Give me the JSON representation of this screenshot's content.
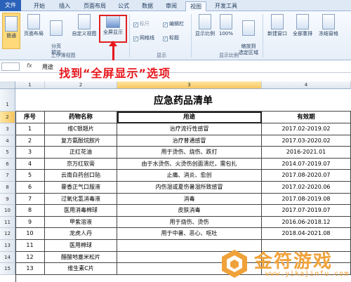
{
  "tabs": [
    "文件",
    "开始",
    "插入",
    "页面布局",
    "公式",
    "数据",
    "审阅",
    "视图",
    "开发工具"
  ],
  "active_tab": "视图",
  "ribbon": {
    "workbook_views": {
      "group_label": "工作簿视图",
      "normal": "普通",
      "page_layout": "页面布局",
      "page_break_preview": "分页\n预览",
      "custom_views": "自定义视图",
      "full_screen": "全屏显示"
    },
    "show": {
      "group_label": "显示",
      "ruler": "标尺",
      "gridlines": "网格线",
      "formula_bar": "编辑栏",
      "headings": "标题"
    },
    "zoom": {
      "group_label": "显示比例",
      "zoom": "显示比例",
      "hundred": "100%",
      "zoom_to_selection": "缩放到\n选定区域"
    },
    "window": {
      "new_window": "新建窗口",
      "arrange_all": "全部重排",
      "freeze_panes": "冻结窗格"
    }
  },
  "formula_bar": {
    "fx": "fx",
    "content": "用途"
  },
  "annotation": "找到“全屏显示”选项",
  "columns": [
    "1",
    "2",
    "3",
    "4"
  ],
  "sheet": {
    "title": "应急药品清单",
    "headers": [
      "序号",
      "药物名称",
      "用途",
      "有效期"
    ],
    "rows": [
      [
        "1",
        "维C银翘片",
        "治疗流行性感冒",
        "2017.02-2019.02"
      ],
      [
        "2",
        "复方氨酚烷胺片",
        "治疗普通感冒",
        "2017.03-2020.02"
      ],
      [
        "3",
        "正红花油",
        "用于烫伤、烧伤、跌打",
        "2016-2021.01"
      ],
      [
        "4",
        "京万红软膏",
        "由于水烫伤、火烫伤创面溃烂，需包扎",
        "2014.07-2019.07"
      ],
      [
        "5",
        "云南白药创口贴",
        "止痛、消炎、愈创",
        "2017.08-2020.07"
      ],
      [
        "6",
        "藿香正气口服液",
        "内伤湿或夏伤暑湿所致感冒",
        "2017.02-2020.06"
      ],
      [
        "7",
        "过氧化氢消毒液",
        "消毒",
        "2017.08-2019.08"
      ],
      [
        "8",
        "医用消毒棉球",
        "皮肤消毒",
        "2017.07-2019.07"
      ],
      [
        "9",
        "甲紫溶液",
        "用于烧伤、烫伤",
        "2016.06-2018.12"
      ],
      [
        "10",
        "龙虎人丹",
        "用于中暑、恶心、呕吐",
        "2018.04-2021.08"
      ],
      [
        "11",
        "医用棉球",
        "",
        ""
      ],
      [
        "12",
        "醋酸地塞米松片",
        "",
        ""
      ],
      [
        "13",
        "维生素C片",
        "",
        ""
      ]
    ]
  },
  "row_numbers": [
    "1",
    "2",
    "3",
    "4",
    "5",
    "6",
    "7",
    "8",
    "9",
    "10",
    "11",
    "12",
    "13",
    "14",
    "15"
  ],
  "watermark": {
    "text": "金符游戏",
    "url": "www.yikajinfu.com"
  },
  "colors": {
    "accent": "#2b62b9",
    "annotation": "#e8151b",
    "watermark": "#f0a23a"
  }
}
